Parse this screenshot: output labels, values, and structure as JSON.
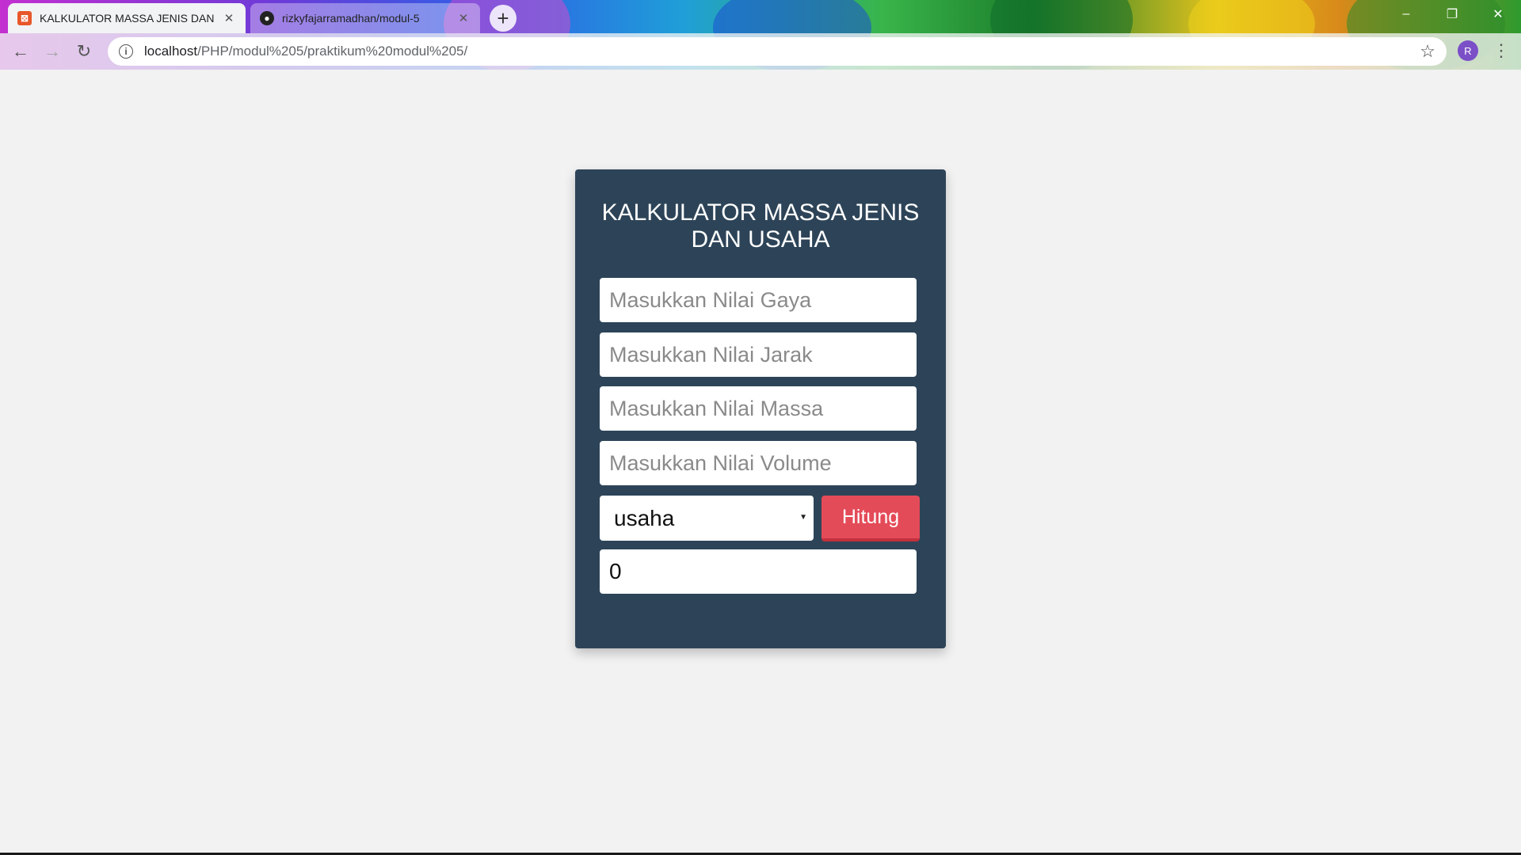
{
  "browser": {
    "tabs": [
      {
        "title": "KALKULATOR MASSA JENIS DAN",
        "active": true,
        "favicon": "xampp-icon"
      },
      {
        "title": "rizkyfajarramadhan/modul-5",
        "active": false,
        "favicon": "github-icon"
      }
    ],
    "url_host": "localhost",
    "url_path": "/PHP/modul%205/praktikum%20modul%205/",
    "profile_initial": "R"
  },
  "calculator": {
    "title": "KALKULATOR MASSA JENIS DAN USAHA",
    "inputs": {
      "gaya_placeholder": "Masukkan Nilai Gaya",
      "jarak_placeholder": "Masukkan Nilai Jarak",
      "massa_placeholder": "Masukkan Nilai Massa",
      "volume_placeholder": "Masukkan Nilai Volume"
    },
    "operation_selected": "usaha",
    "submit_label": "Hitung",
    "result_value": "0"
  },
  "colors": {
    "card_bg": "#2d4458",
    "button_bg": "#e44b58",
    "page_bg": "#f2f2f2"
  }
}
